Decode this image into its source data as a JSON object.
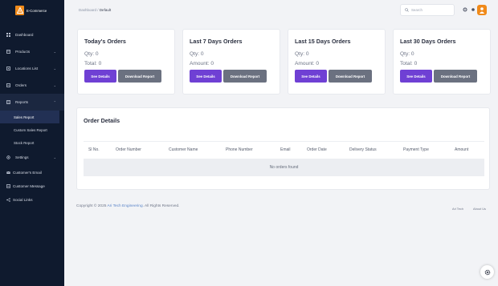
{
  "brand": {
    "name": "E-Commerce"
  },
  "sidebar": {
    "items": [
      {
        "label": "Dashboard",
        "icon": "grid-icon"
      },
      {
        "label": "Products",
        "icon": "box-icon"
      },
      {
        "label": "Locations List",
        "icon": "pin-icon"
      },
      {
        "label": "Orders",
        "icon": "cart-icon"
      },
      {
        "label": "Reports",
        "icon": "report-icon"
      }
    ],
    "sub_items": [
      {
        "label": "Sales Report"
      },
      {
        "label": "Custom Sales Report"
      },
      {
        "label": "Stock Report"
      }
    ],
    "settings": {
      "label": "Settings"
    },
    "extra": [
      {
        "label": "Customer's Email"
      },
      {
        "label": "Customer Message"
      },
      {
        "label": "Social Links"
      }
    ]
  },
  "breadcrumb": {
    "root": "Dashboard",
    "sep": "/",
    "current": "Default"
  },
  "search": {
    "placeholder": "Search"
  },
  "cards": [
    {
      "title": "Today's Orders",
      "line1": "Qty: 0",
      "line2": "Total: 0",
      "see": "See Details",
      "download": "Download Report"
    },
    {
      "title": "Last 7 Days Orders",
      "line1": "Qty: 0",
      "line2": "Amount: 0",
      "see": "See Details",
      "download": "Download Report"
    },
    {
      "title": "Last 15 Days Orders",
      "line1": "Qty: 0",
      "line2": "Amount: 0",
      "see": "See Details",
      "download": "Download Report"
    },
    {
      "title": "Last 30 Days Orders",
      "line1": "Qty: 0",
      "line2": "Total: 0",
      "see": "See Details",
      "download": "Download Report"
    }
  ],
  "orders": {
    "title": "Order Details",
    "columns": [
      "Sl No.",
      "Order Number",
      "Customer Name",
      "Phone Number",
      "Email",
      "Order Date",
      "Delivery Status",
      "Payment Type",
      "Amount"
    ],
    "empty": "No orders found"
  },
  "footer": {
    "prefix": "Copyright © 2025 ",
    "company": "Ari Tech Engineering",
    "suffix": ". All Rights Reserved.",
    "links": [
      "Ari Tech",
      "About Us"
    ]
  },
  "colors": {
    "sidebar": "#0f1a2e",
    "accent": "#6f40d4",
    "secondary_button": "#6b7180",
    "brand": "#f08a1a"
  }
}
